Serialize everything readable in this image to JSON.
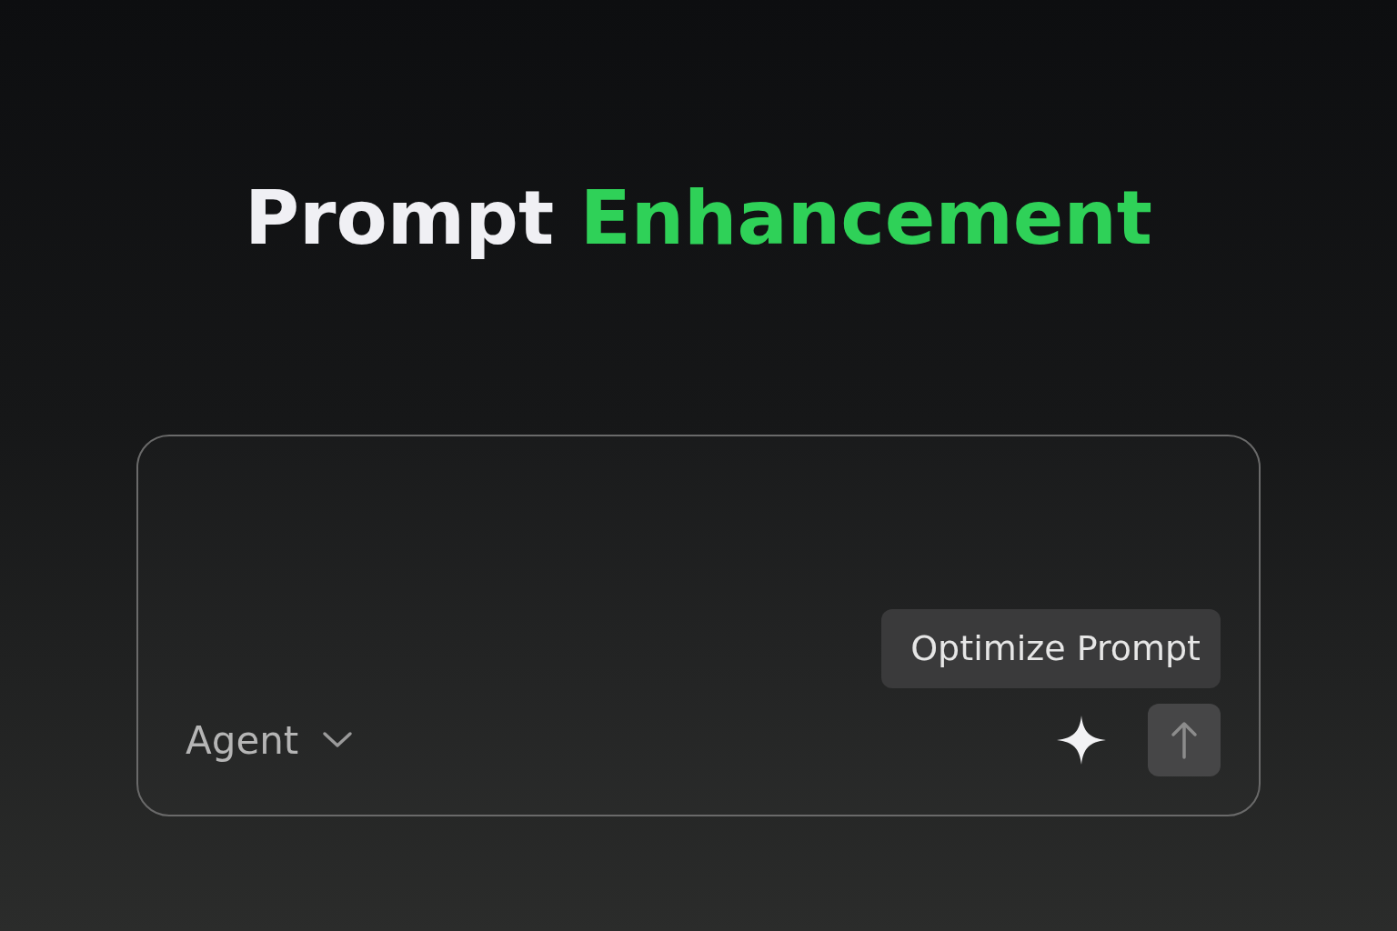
{
  "title": {
    "parts": [
      {
        "text": "Prompt",
        "accent": false
      },
      {
        "text": "Enhancement",
        "accent": true
      }
    ]
  },
  "composer": {
    "tooltip": "Optimize Prompt",
    "agent_selector": {
      "label": "Agent",
      "expanded": false
    },
    "send_button": {
      "disabled": true
    }
  }
}
